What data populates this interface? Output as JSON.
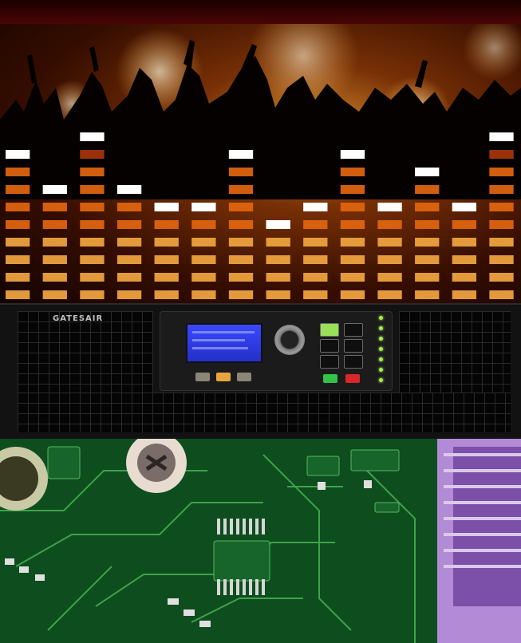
{
  "device": {
    "brand": "GATESAIR"
  },
  "equalizer": {
    "levels": [
      0.72,
      0.55,
      0.82,
      0.55,
      0.47,
      0.47,
      0.7,
      0.32,
      0.47,
      0.7,
      0.42,
      0.62,
      0.47,
      0.82
    ]
  },
  "icons": [
    "crowd-silhouette",
    "control-knob",
    "screw",
    "chip"
  ],
  "colors": {
    "stage_glow": "#ff9a30",
    "eq_bar": "#e2660f",
    "eq_peak": "#ffffff",
    "lcd": "#2f3cf0",
    "pcb": "#0d4d1e",
    "chip": "#b38ad6"
  }
}
